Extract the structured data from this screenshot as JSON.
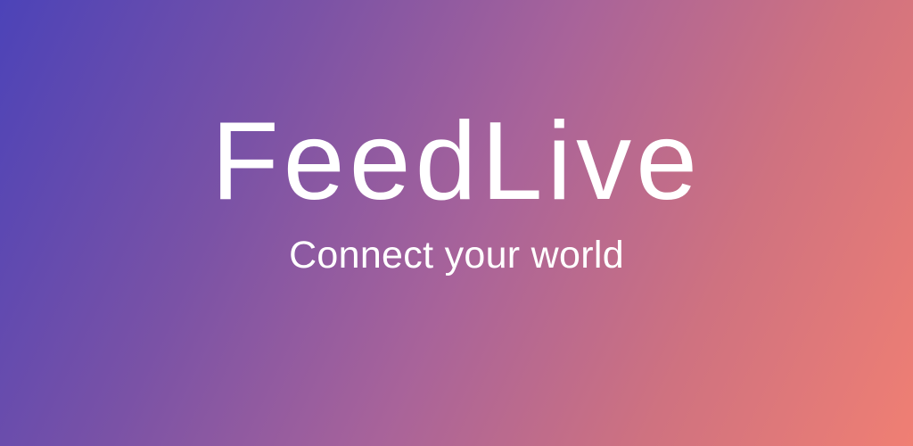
{
  "brand": {
    "name": "FeedLive",
    "tagline": "Connect your world"
  },
  "colors": {
    "gradient_start": "#4c43b8",
    "gradient_end": "#f07f73",
    "text": "#ffffff"
  }
}
